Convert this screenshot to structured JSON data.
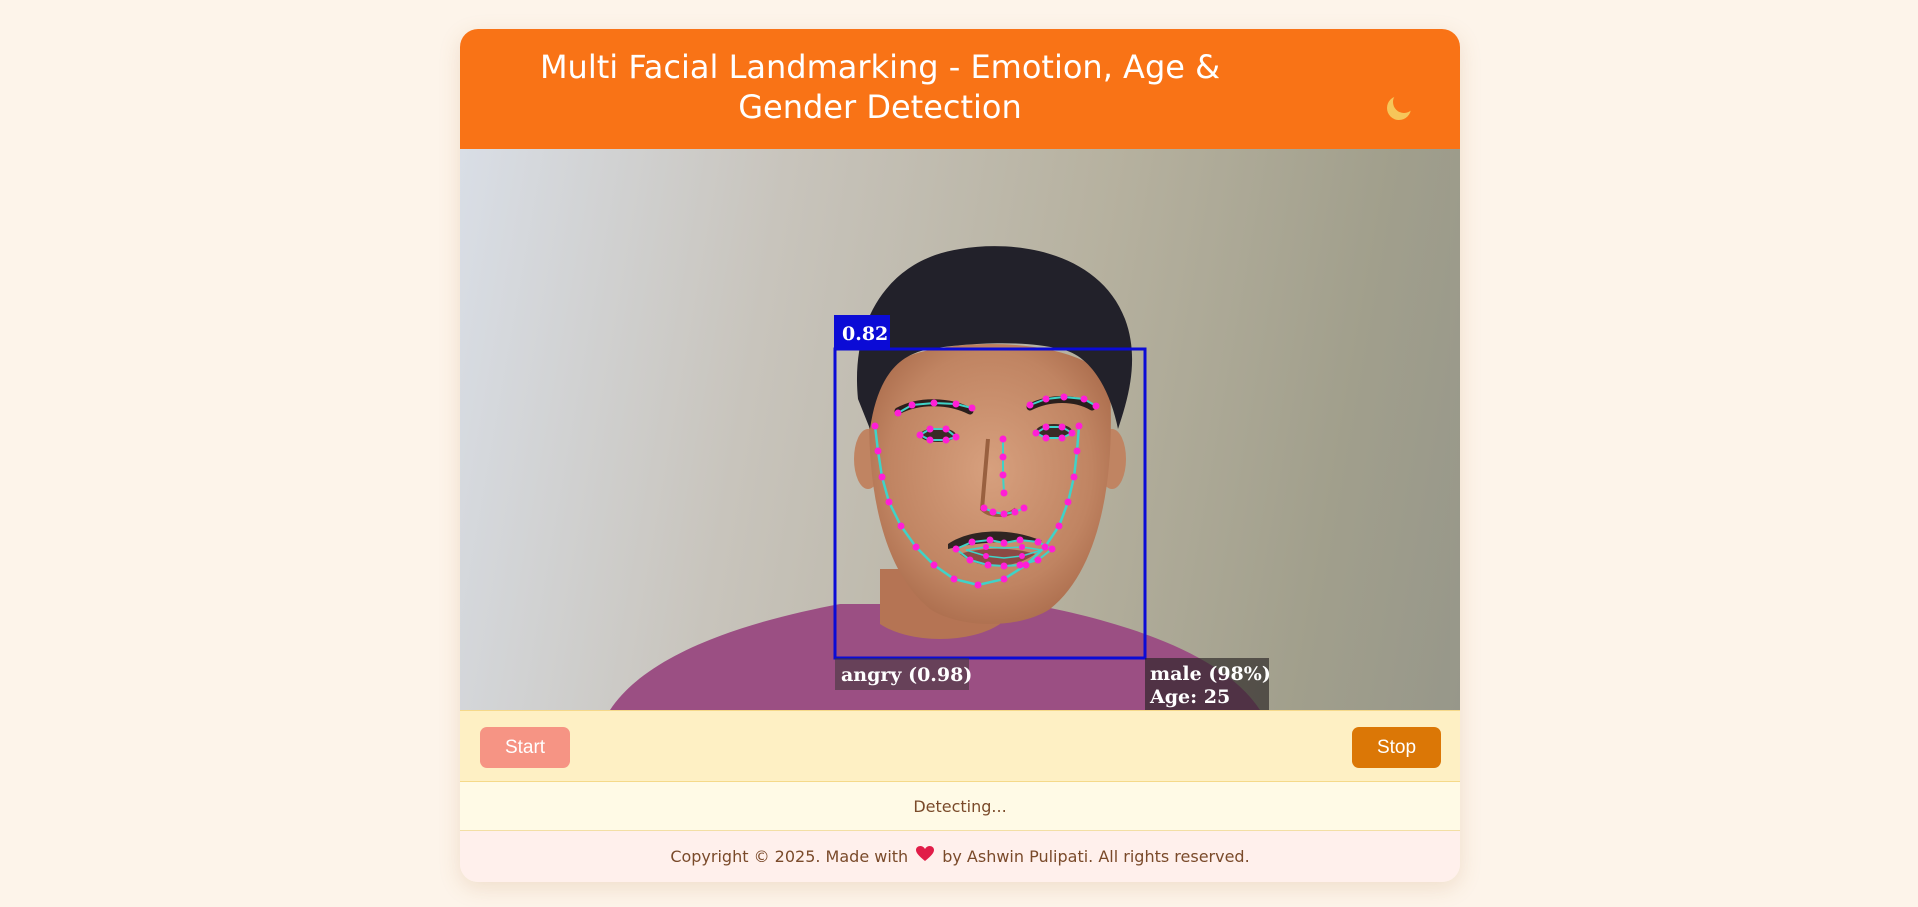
{
  "header": {
    "title": "Multi Facial Landmarking - Emotion, Age & Gender Detection",
    "theme_icon": "crescent-moon-icon"
  },
  "video": {
    "detection_score": "0.82",
    "emotion_label": "angry (0.98)",
    "gender_label": "male (98%)",
    "age_label": "Age: 25",
    "box_color": "#0b0bd6",
    "landmark_color": "#ff1ed6",
    "mesh_color": "#3fd3c8"
  },
  "controls": {
    "start_label": "Start",
    "stop_label": "Stop"
  },
  "status": {
    "text": "Detecting..."
  },
  "footer": {
    "copyright_prefix": "Copyright © 2025. Made with",
    "heart_icon": "heart-icon",
    "copyright_suffix": "by Ashwin Pulipati. All rights reserved."
  },
  "colors": {
    "accent": "#f97316",
    "page_background": "#fdf4ea",
    "start_button": "#f69484",
    "stop_button": "#db7706"
  }
}
